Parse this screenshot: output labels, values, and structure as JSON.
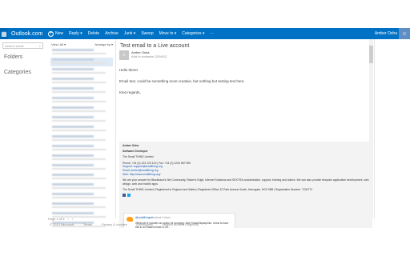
{
  "header": {
    "brand": "Outlook.com",
    "toolbar": [
      "New",
      "Reply ▾",
      "Delete",
      "Archive",
      "Junk ▾",
      "Sweep",
      "Move to ▾",
      "Categories ▾",
      "···"
    ],
    "user_name": "Amber Osha"
  },
  "nav": {
    "search_placeholder": "Search email",
    "folders_label": "Folders",
    "categories_label": "Categories"
  },
  "list": {
    "view_label": "View: All ▾",
    "arrange_label": "Arrange by ▾",
    "message_count": 20,
    "pager": [
      "Page 1 of 5",
      "‹",
      "›"
    ]
  },
  "reading": {
    "subject": "Test email to a Live account",
    "sender_name": "Amber Osha",
    "sender_detail": "Add to contacts 12/04/12",
    "greeting": "Hello there!",
    "body_text": "Email text, could be something more creative, but nothing but testing text here.",
    "closing": "Kind regards,"
  },
  "signature": {
    "name": "Amber Osha",
    "title": "Software Developer",
    "company": "The Small THING Limited",
    "phone": "Phone: +44 (0) 123 123 123 | Fax: +44 (0) 1234 567 890",
    "support": "Support: support@smallthing.org",
    "email": "Email: amber@smallthing.org",
    "web": "Web: http://www.smallthing.org/",
    "about": "We are your answer for Blackbaud's Net Community, Raiser's Edge, Internet Solutions and SEKTRA customisation, support, training and advice. We can also provide bespoke application development, web design, web and mobile apps.",
    "legal": "The Small THING Limited | Registered in England and Wales | Registered Office 32 Park Avenue South, Harrogate, HG2 9BB | Registration Number: 7234772",
    "tweet_user": "@smallthingweb",
    "tweet_meta": "about 4 hours",
    "tweet_line1": "@thecobt It includes an option for grouping. Nice Kiosk/Display/Info. Great to have this in an Raisers Edge & Go...",
    "tweet_line2": "#NetSOLONAL #contact #lead #update for your site. http://t.co/Xk8uQdn",
    "tweet_line3": "$nQKuudfEe Available: http://t.co/HfyFQcgSP"
  },
  "footer": {
    "items": [
      "© 2013 Microsoft",
      "Terms",
      "Privacy & cookies",
      "Developers",
      "English (United Kingdom)"
    ]
  },
  "colors": {
    "accent": "#0072c6",
    "link": "#1a5db4"
  }
}
